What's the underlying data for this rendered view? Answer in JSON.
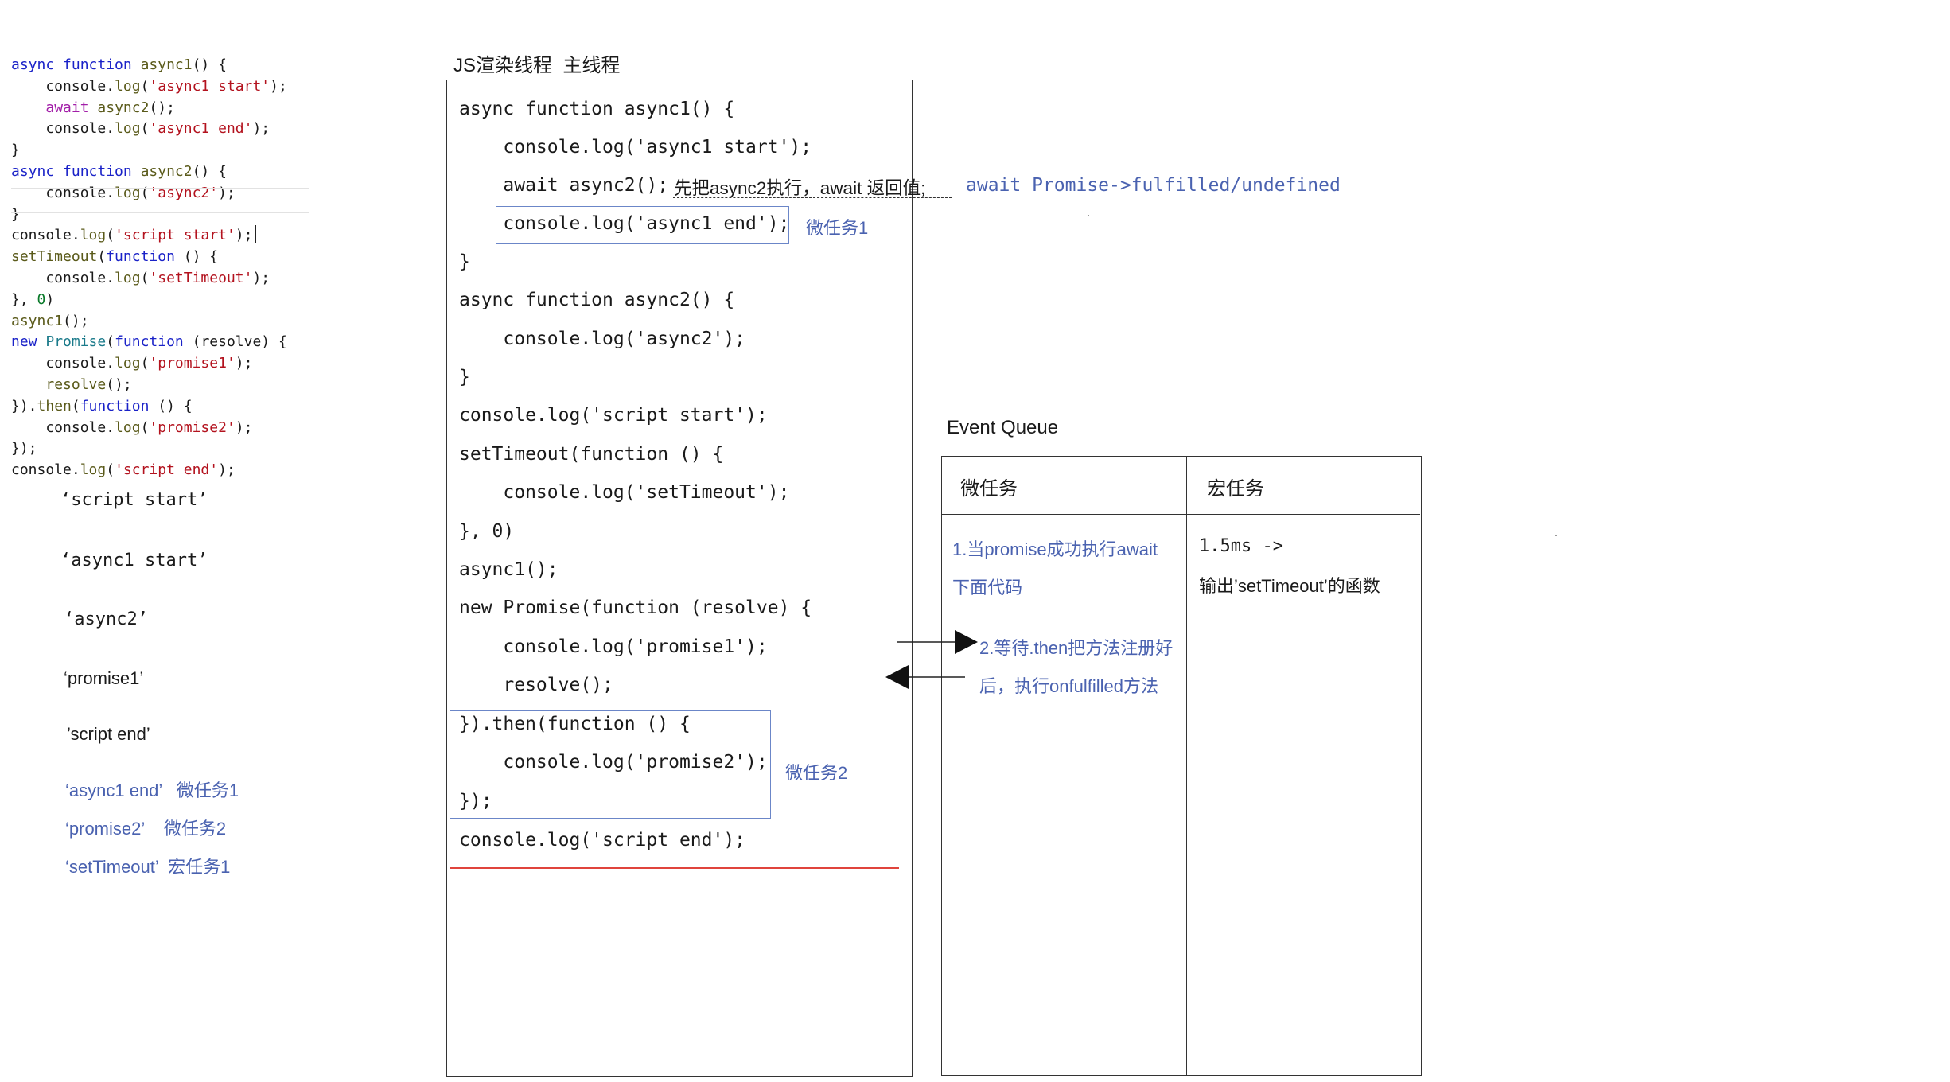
{
  "editor": {
    "lines": [
      [
        {
          "t": "async function ",
          "c": "kw"
        },
        {
          "t": "async1",
          "c": "fn"
        },
        {
          "t": "() {",
          "c": ""
        }
      ],
      [
        {
          "t": "    console.",
          "c": ""
        },
        {
          "t": "log",
          "c": "fn"
        },
        {
          "t": "(",
          "c": ""
        },
        {
          "t": "'async1 start'",
          "c": "str"
        },
        {
          "t": ");",
          "c": ""
        }
      ],
      [
        {
          "t": "    ",
          "c": ""
        },
        {
          "t": "await",
          "c": "kw2"
        },
        {
          "t": " ",
          "c": ""
        },
        {
          "t": "async2",
          "c": "fn"
        },
        {
          "t": "();",
          "c": ""
        }
      ],
      [
        {
          "t": "    console.",
          "c": ""
        },
        {
          "t": "log",
          "c": "fn"
        },
        {
          "t": "(",
          "c": ""
        },
        {
          "t": "'async1 end'",
          "c": "str"
        },
        {
          "t": ");",
          "c": ""
        }
      ],
      [
        {
          "t": "}",
          "c": ""
        }
      ],
      [
        {
          "t": "async function ",
          "c": "kw"
        },
        {
          "t": "async2",
          "c": "fn"
        },
        {
          "t": "() {",
          "c": ""
        }
      ],
      [
        {
          "t": "    console.",
          "c": ""
        },
        {
          "t": "log",
          "c": "fn"
        },
        {
          "t": "(",
          "c": ""
        },
        {
          "t": "'async2'",
          "c": "str"
        },
        {
          "t": ");",
          "c": ""
        }
      ],
      [
        {
          "t": "}",
          "c": ""
        }
      ],
      [
        {
          "t": "console.",
          "c": ""
        },
        {
          "t": "log",
          "c": "fn"
        },
        {
          "t": "(",
          "c": ""
        },
        {
          "t": "'script start'",
          "c": "str"
        },
        {
          "t": ");",
          "c": ""
        }
      ],
      [
        {
          "t": "setTimeout",
          "c": "fn"
        },
        {
          "t": "(",
          "c": ""
        },
        {
          "t": "function",
          "c": "kw"
        },
        {
          "t": " () {",
          "c": ""
        }
      ],
      [
        {
          "t": "    console.",
          "c": ""
        },
        {
          "t": "log",
          "c": "fn"
        },
        {
          "t": "(",
          "c": ""
        },
        {
          "t": "'setTimeout'",
          "c": "str"
        },
        {
          "t": ");",
          "c": ""
        }
      ],
      [
        {
          "t": "}, ",
          "c": ""
        },
        {
          "t": "0",
          "c": "num"
        },
        {
          "t": ")",
          "c": ""
        }
      ],
      [
        {
          "t": "async1",
          "c": "fn"
        },
        {
          "t": "();",
          "c": ""
        }
      ],
      [
        {
          "t": "new ",
          "c": "kw"
        },
        {
          "t": "Promise",
          "c": "cls"
        },
        {
          "t": "(",
          "c": ""
        },
        {
          "t": "function",
          "c": "kw"
        },
        {
          "t": " (resolve) {",
          "c": ""
        }
      ],
      [
        {
          "t": "    console.",
          "c": ""
        },
        {
          "t": "log",
          "c": "fn"
        },
        {
          "t": "(",
          "c": ""
        },
        {
          "t": "'promise1'",
          "c": "str"
        },
        {
          "t": ");",
          "c": ""
        }
      ],
      [
        {
          "t": "    ",
          "c": ""
        },
        {
          "t": "resolve",
          "c": "fn"
        },
        {
          "t": "();",
          "c": ""
        }
      ],
      [
        {
          "t": "}).",
          "c": ""
        },
        {
          "t": "then",
          "c": "fn"
        },
        {
          "t": "(",
          "c": ""
        },
        {
          "t": "function",
          "c": "kw"
        },
        {
          "t": " () {",
          "c": ""
        }
      ],
      [
        {
          "t": "    console.",
          "c": ""
        },
        {
          "t": "log",
          "c": "fn"
        },
        {
          "t": "(",
          "c": ""
        },
        {
          "t": "'promise2'",
          "c": "str"
        },
        {
          "t": ");",
          "c": ""
        }
      ],
      [
        {
          "t": "});",
          "c": ""
        }
      ],
      [
        {
          "t": "console.",
          "c": ""
        },
        {
          "t": "log",
          "c": "fn"
        },
        {
          "t": "(",
          "c": ""
        },
        {
          "t": "'script end'",
          "c": "str"
        },
        {
          "t": ");",
          "c": ""
        }
      ]
    ]
  },
  "output": {
    "script_start": "‘script start’",
    "async1_start": "‘async1 start’",
    "async2": "‘async2’",
    "promise1": "‘promise1’",
    "script_end": "’script end’",
    "async1_end": "‘async1 end’   微任务1",
    "promise2": "‘promise2’    微任务2",
    "settimeout": "‘setTimeout’  宏任务1"
  },
  "main_thread": {
    "title": "JS渲染线程  主线程",
    "lines": [
      "async function async1() {",
      "    console.log('async1 start');",
      "    await async2();",
      "    console.log('async1 end');",
      "}",
      "async function async2() {",
      "    console.log('async2');",
      "}",
      "console.log('script start');",
      "setTimeout(function () {",
      "    console.log('setTimeout');",
      "}, 0)",
      "async1();",
      "new Promise(function (resolve) {",
      "    console.log('promise1');",
      "    resolve();",
      "}).then(function () {",
      "    console.log('promise2');",
      "});",
      "console.log('script end');"
    ],
    "await_note": "先把async2执行，await 返回值;",
    "await_promise_note": "await Promise->fulfilled/undefined",
    "micro1_label": "微任务1",
    "micro2_label": "微任务2"
  },
  "event_queue": {
    "title": "Event Queue",
    "micro_header": "微任务",
    "macro_header": "宏任务",
    "micro_item1_line1": "1.当promise成功执行await",
    "micro_item1_line2": "下面代码",
    "micro_item2_line1": "2.等待.then把方法注册好",
    "micro_item2_line2": "后，执行onfulfilled方法",
    "macro_line1": "1.5ms ->",
    "macro_line2": "输出’setTimeout’的函数"
  },
  "colors": {
    "annotation_blue": "#4a62b0",
    "highlight_box": "#6b86c8",
    "end_line_red": "#e0443c"
  }
}
